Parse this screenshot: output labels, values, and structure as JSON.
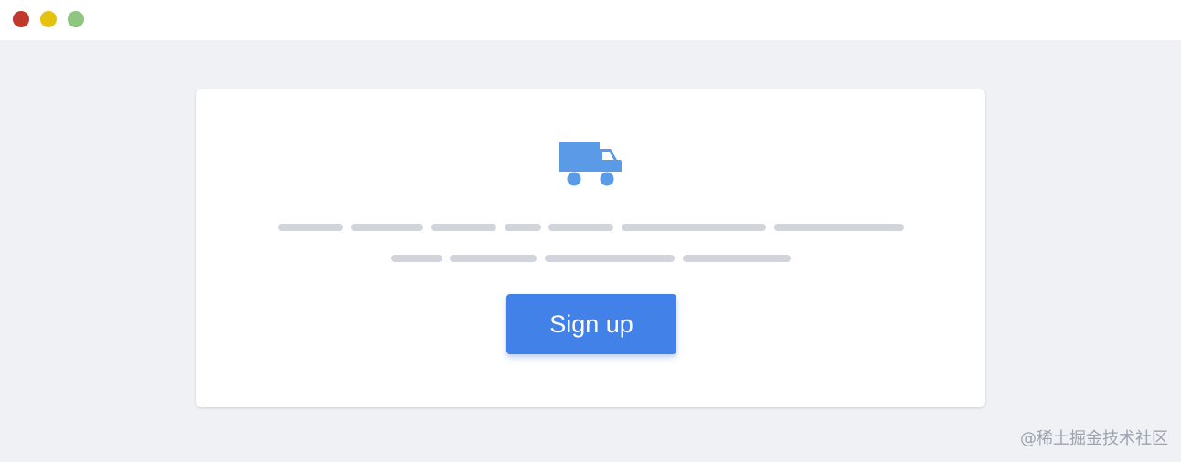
{
  "window": {
    "controls": [
      {
        "name": "close",
        "color": "#c0392b"
      },
      {
        "name": "minimize",
        "color": "#e5c20f"
      },
      {
        "name": "maximize",
        "color": "#8ec57f"
      }
    ]
  },
  "card": {
    "icon": "truck-icon",
    "icon_color": "#5b9ae6",
    "placeholder_color": "#d1d5db",
    "cta": {
      "label": "Sign up",
      "color": "#4281e8"
    }
  },
  "watermark": {
    "text": "@稀土掘金技术社区"
  }
}
